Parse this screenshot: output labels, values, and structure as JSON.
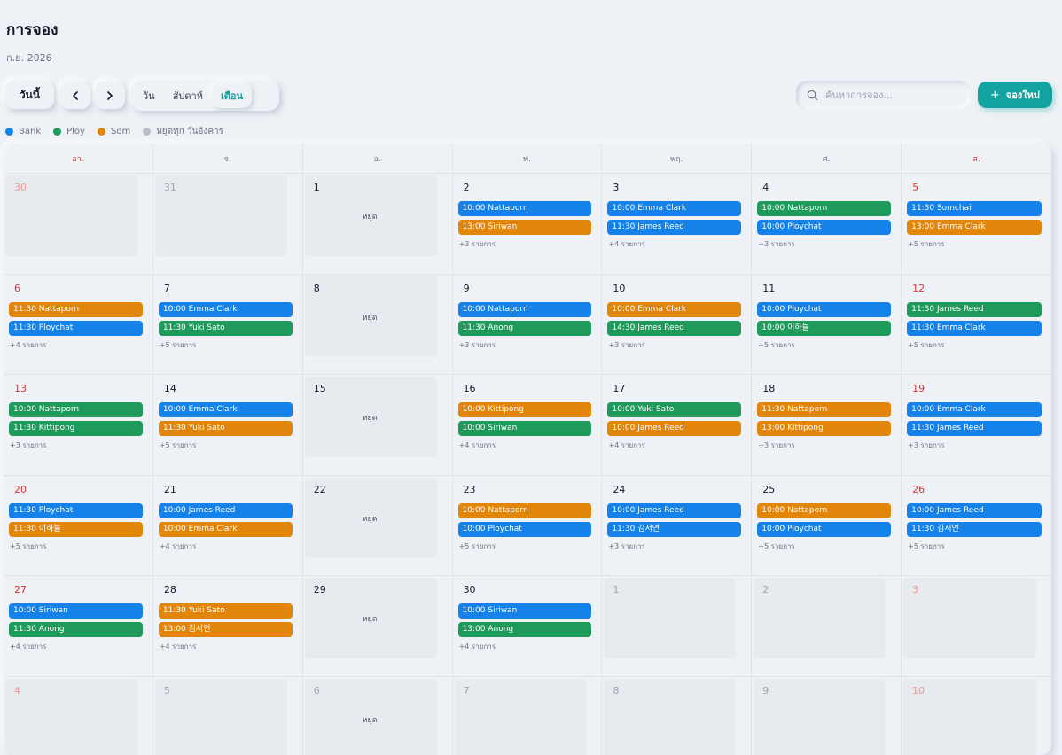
{
  "header": {
    "title": "การจอง",
    "subtitle": "ก.ย. 2026"
  },
  "toolbar": {
    "today_label": "วันนี้",
    "views": [
      {
        "label": "วัน",
        "active": false
      },
      {
        "label": "สัปดาห์",
        "active": false
      },
      {
        "label": "เดือน",
        "active": true
      }
    ],
    "search_placeholder": "ค้นหาการจอง...",
    "new_label": "จองใหม่",
    "new_icon": "plus"
  },
  "legend": [
    {
      "label": "Bank",
      "color": "#1482e8"
    },
    {
      "label": "Ploy",
      "color": "#1e9b5a"
    },
    {
      "label": "Som",
      "color": "#e2850b"
    },
    {
      "label": "หยุดทุก วันอังคาร",
      "color": "#b8bec8"
    }
  ],
  "colors": {
    "accent": "#13a3a0",
    "blue": "#1482e8",
    "green": "#1e9b5a",
    "orange": "#e2850b",
    "weekend": "#e0342c"
  },
  "weekdays": [
    "อา.",
    "จ.",
    "อ.",
    "พ.",
    "พฤ.",
    "ศ.",
    "ส."
  ],
  "closed_label": "หยุด",
  "days": [
    {
      "day": "30",
      "off": true
    },
    {
      "day": "31",
      "off": true
    },
    {
      "day": "1",
      "closed": true
    },
    {
      "day": "2",
      "events": [
        {
          "text": "10:00 Nattaporn",
          "color": "blue"
        },
        {
          "text": "13:00 Siriwan",
          "color": "orange"
        }
      ],
      "more": "+3 รายการ"
    },
    {
      "day": "3",
      "events": [
        {
          "text": "10:00 Emma Clark",
          "color": "blue"
        },
        {
          "text": "11:30 James Reed",
          "color": "blue"
        }
      ],
      "more": "+4 รายการ"
    },
    {
      "day": "4",
      "events": [
        {
          "text": "10:00 Nattaporn",
          "color": "green"
        },
        {
          "text": "10:00 Ploychat",
          "color": "blue"
        }
      ],
      "more": "+3 รายการ"
    },
    {
      "day": "5",
      "events": [
        {
          "text": "11:30 Somchai",
          "color": "blue"
        },
        {
          "text": "13:00 Emma Clark",
          "color": "orange"
        }
      ],
      "more": "+5 รายการ"
    },
    {
      "day": "6",
      "events": [
        {
          "text": "11:30 Nattaporn",
          "color": "orange"
        },
        {
          "text": "11:30 Ploychat",
          "color": "blue"
        }
      ],
      "more": "+4 รายการ"
    },
    {
      "day": "7",
      "events": [
        {
          "text": "10:00 Emma Clark",
          "color": "blue"
        },
        {
          "text": "11:30 Yuki Sato",
          "color": "green"
        }
      ],
      "more": "+5 รายการ"
    },
    {
      "day": "8",
      "closed": true
    },
    {
      "day": "9",
      "events": [
        {
          "text": "10:00 Nattaporn",
          "color": "blue"
        },
        {
          "text": "11:30 Anong",
          "color": "green"
        }
      ],
      "more": "+3 รายการ"
    },
    {
      "day": "10",
      "events": [
        {
          "text": "10:00 Emma Clark",
          "color": "orange"
        },
        {
          "text": "14:30 James Reed",
          "color": "green"
        }
      ],
      "more": "+3 รายการ"
    },
    {
      "day": "11",
      "events": [
        {
          "text": "10:00 Ploychat",
          "color": "blue"
        },
        {
          "text": "10:00 이하늘",
          "color": "green"
        }
      ],
      "more": "+5 รายการ"
    },
    {
      "day": "12",
      "events": [
        {
          "text": "11:30 James Reed",
          "color": "green"
        },
        {
          "text": "11:30 Emma Clark",
          "color": "blue"
        }
      ],
      "more": "+5 รายการ"
    },
    {
      "day": "13",
      "events": [
        {
          "text": "10:00 Nattaporn",
          "color": "green"
        },
        {
          "text": "11:30 Kittipong",
          "color": "green"
        }
      ],
      "more": "+3 รายการ"
    },
    {
      "day": "14",
      "events": [
        {
          "text": "10:00 Emma Clark",
          "color": "blue"
        },
        {
          "text": "11:30 Yuki Sato",
          "color": "orange"
        }
      ],
      "more": "+5 รายการ"
    },
    {
      "day": "15",
      "closed": true
    },
    {
      "day": "16",
      "events": [
        {
          "text": "10:00 Kittipong",
          "color": "orange"
        },
        {
          "text": "10:00 Siriwan",
          "color": "green"
        }
      ],
      "more": "+4 รายการ"
    },
    {
      "day": "17",
      "events": [
        {
          "text": "10:00 Yuki Sato",
          "color": "green"
        },
        {
          "text": "10:00 James Reed",
          "color": "orange"
        }
      ],
      "more": "+4 รายการ"
    },
    {
      "day": "18",
      "events": [
        {
          "text": "11:30 Nattaporn",
          "color": "orange"
        },
        {
          "text": "13:00 Kittipong",
          "color": "orange"
        }
      ],
      "more": "+3 รายการ"
    },
    {
      "day": "19",
      "events": [
        {
          "text": "10:00 Emma Clark",
          "color": "blue"
        },
        {
          "text": "11:30 James Reed",
          "color": "blue"
        }
      ],
      "more": "+3 รายการ"
    },
    {
      "day": "20",
      "events": [
        {
          "text": "11:30 Ploychat",
          "color": "blue"
        },
        {
          "text": "11:30 이하늘",
          "color": "orange"
        }
      ],
      "more": "+5 รายการ"
    },
    {
      "day": "21",
      "events": [
        {
          "text": "10:00 James Reed",
          "color": "blue"
        },
        {
          "text": "10:00 Emma Clark",
          "color": "orange"
        }
      ],
      "more": "+4 รายการ"
    },
    {
      "day": "22",
      "closed": true
    },
    {
      "day": "23",
      "events": [
        {
          "text": "10:00 Nattaporn",
          "color": "orange"
        },
        {
          "text": "10:00 Ploychat",
          "color": "blue"
        }
      ],
      "more": "+5 รายการ"
    },
    {
      "day": "24",
      "events": [
        {
          "text": "10:00 James Reed",
          "color": "blue"
        },
        {
          "text": "11:30 김서연",
          "color": "blue"
        }
      ],
      "more": "+3 รายการ"
    },
    {
      "day": "25",
      "events": [
        {
          "text": "10:00 Nattaporn",
          "color": "orange"
        },
        {
          "text": "10:00 Ploychat",
          "color": "blue"
        }
      ],
      "more": "+5 รายการ"
    },
    {
      "day": "26",
      "events": [
        {
          "text": "10:00 James Reed",
          "color": "blue"
        },
        {
          "text": "11:30 김서연",
          "color": "blue"
        }
      ],
      "more": "+5 รายการ"
    },
    {
      "day": "27",
      "events": [
        {
          "text": "10:00 Siriwan",
          "color": "blue"
        },
        {
          "text": "11:30 Anong",
          "color": "green"
        }
      ],
      "more": "+4 รายการ"
    },
    {
      "day": "28",
      "events": [
        {
          "text": "11:30 Yuki Sato",
          "color": "orange"
        },
        {
          "text": "13:00 김서연",
          "color": "orange"
        }
      ],
      "more": "+4 รายการ"
    },
    {
      "day": "29",
      "closed": true
    },
    {
      "day": "30",
      "events": [
        {
          "text": "10:00 Siriwan",
          "color": "blue"
        },
        {
          "text": "13:00 Anong",
          "color": "green"
        }
      ],
      "more": "+4 รายการ"
    },
    {
      "day": "1",
      "off": true
    },
    {
      "day": "2",
      "off": true
    },
    {
      "day": "3",
      "off": true
    },
    {
      "day": "4",
      "off": true
    },
    {
      "day": "5",
      "off": true
    },
    {
      "day": "6",
      "off": true,
      "closed": true
    },
    {
      "day": "7",
      "off": true
    },
    {
      "day": "8",
      "off": true
    },
    {
      "day": "9",
      "off": true
    },
    {
      "day": "10",
      "off": true
    }
  ]
}
